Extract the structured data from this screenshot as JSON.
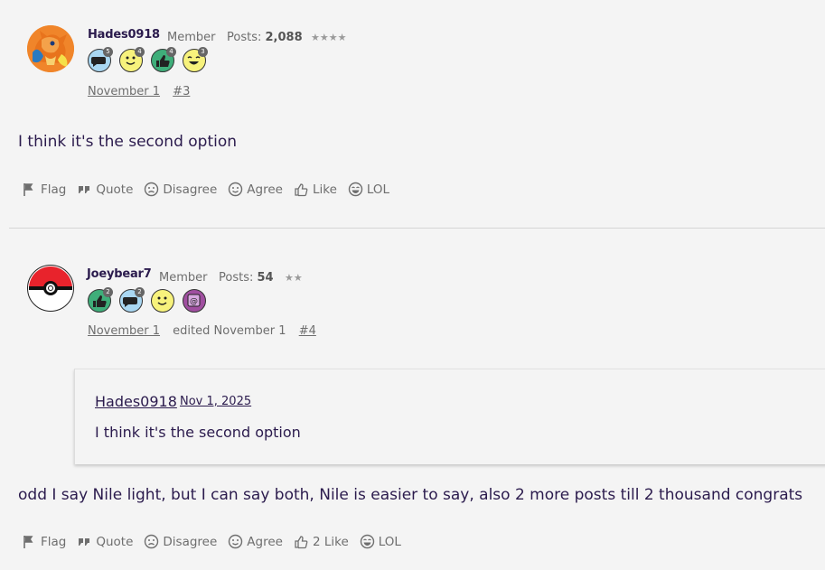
{
  "posts": [
    {
      "username": "Hades0918",
      "role": "Member",
      "posts_label": "Posts:",
      "posts_count": "2,088",
      "stars": "★★★★",
      "badges": [
        {
          "icon": "comment-badge-icon",
          "count": "5",
          "color": "#a9d7f2"
        },
        {
          "icon": "smile-badge-icon",
          "count": "4",
          "color": "#f7f27c"
        },
        {
          "icon": "thumbs-up-badge-icon",
          "count": "4",
          "color": "#3fae7a"
        },
        {
          "icon": "laugh-badge-icon",
          "count": "3",
          "color": "#f7f27c"
        }
      ],
      "date": "November 1",
      "permalink": "#3",
      "body": "I think it's the second option",
      "actions": {
        "flag": "Flag",
        "quote": "Quote",
        "disagree": "Disagree",
        "agree": "Agree",
        "like": "Like",
        "lol": "LOL"
      }
    },
    {
      "username": "Joeybear7",
      "role": "Member",
      "posts_label": "Posts:",
      "posts_count": "54",
      "stars": "★★",
      "badges": [
        {
          "icon": "thumbs-up-badge-icon",
          "count": "2",
          "color": "#3fae7a"
        },
        {
          "icon": "comment-badge-icon",
          "count": "2",
          "color": "#a9d7f2"
        },
        {
          "icon": "smile-badge-icon",
          "count": "",
          "color": "#f7f27c"
        },
        {
          "icon": "at-badge-icon",
          "count": "",
          "color": "#a04fa0"
        }
      ],
      "date": "November 1",
      "edited": "edited November 1",
      "permalink": "#4",
      "quote": {
        "user": "Hades0918",
        "date": "Nov 1, 2025",
        "text": "I think it's the second option"
      },
      "body": "odd I say Nile light, but I can say both, Nile is easier to say, also 2 more posts till 2 thousand congrats",
      "actions": {
        "flag": "Flag",
        "quote": "Quote",
        "disagree": "Disagree",
        "agree": "Agree",
        "like": "2 Like",
        "lol": "LOL"
      }
    }
  ]
}
